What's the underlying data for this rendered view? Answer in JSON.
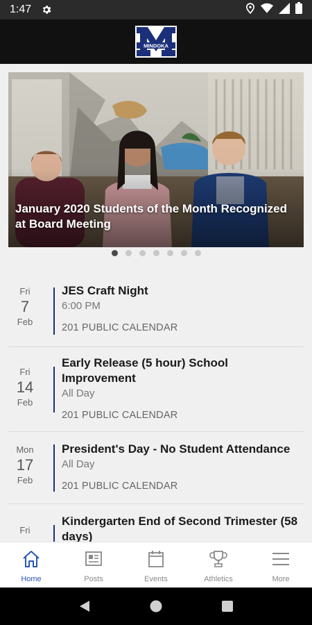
{
  "status_bar": {
    "time": "1:47"
  },
  "header": {
    "logo_text": "MINDOKA"
  },
  "carousel": {
    "caption": "January 2020 Students of the Month Recognized at Board Meeting",
    "dots": 7,
    "active_index": 0
  },
  "events": [
    {
      "dow": "Fri",
      "day": "7",
      "month": "Feb",
      "title": "JES Craft Night",
      "time": "6:00 PM",
      "calendar": "201 PUBLIC CALENDAR"
    },
    {
      "dow": "Fri",
      "day": "14",
      "month": "Feb",
      "title": "Early Release (5 hour) School Improvement",
      "time": "All Day",
      "calendar": "201 PUBLIC CALENDAR"
    },
    {
      "dow": "Mon",
      "day": "17",
      "month": "Feb",
      "title": "President's Day - No Student Attendance",
      "time": "All Day",
      "calendar": "201 PUBLIC CALENDAR"
    },
    {
      "dow": "Fri",
      "day": "",
      "month": "",
      "title": "Kindergarten End of Second Trimester (58 days)",
      "time": "",
      "calendar": ""
    }
  ],
  "bottom_nav": [
    {
      "label": "Home",
      "icon": "home-icon",
      "active": true
    },
    {
      "label": "Posts",
      "icon": "posts-icon",
      "active": false
    },
    {
      "label": "Events",
      "icon": "calendar-icon",
      "active": false
    },
    {
      "label": "Athletics",
      "icon": "trophy-icon",
      "active": false
    },
    {
      "label": "More",
      "icon": "menu-icon",
      "active": false
    }
  ],
  "colors": {
    "accent": "#2a55b8",
    "brand_blue": "#1c2f7a",
    "header_bg": "#111111"
  }
}
